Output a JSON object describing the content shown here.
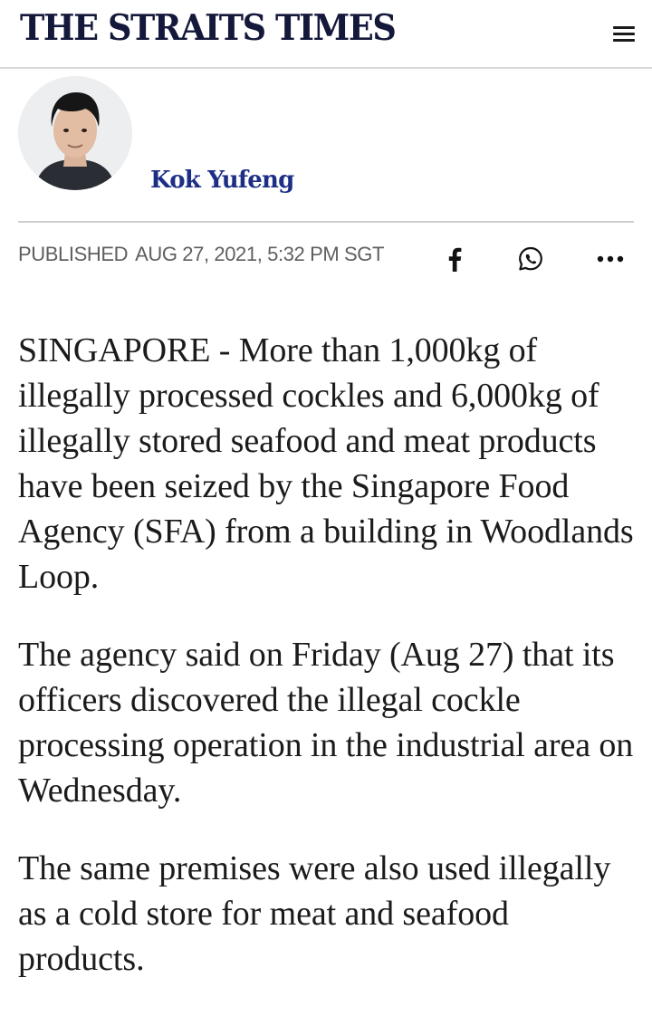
{
  "header": {
    "logo_text": "THE STRAITS TIMES",
    "menu_icon": "hamburger-menu-icon"
  },
  "byline": {
    "author": "Kok Yufeng",
    "avatar_icon": "author-avatar"
  },
  "meta": {
    "published_label": "PUBLISHED",
    "published_date": "AUG 27, 2021, 5:32 PM SGT",
    "share_icons": [
      "facebook-icon",
      "whatsapp-icon",
      "more-icon"
    ]
  },
  "article": {
    "paragraphs": [
      "SINGAPORE - More than 1,000kg of illegally processed cockles and 6,000kg of illegally stored seafood and meat products have been seized by the Singapore Food Agency (SFA) from a building in Woodlands Loop.",
      "The agency said on Friday (Aug 27) that its officers discovered the illegal cockle processing operation in the industrial area on Wednesday.",
      "The same premises were also used illegally as a cold store for meat and seafood products."
    ]
  },
  "colors": {
    "logo": "#14183a",
    "author": "#1d2e87",
    "meta_text": "#5f5f5f",
    "divider": "#d9d9d9"
  }
}
